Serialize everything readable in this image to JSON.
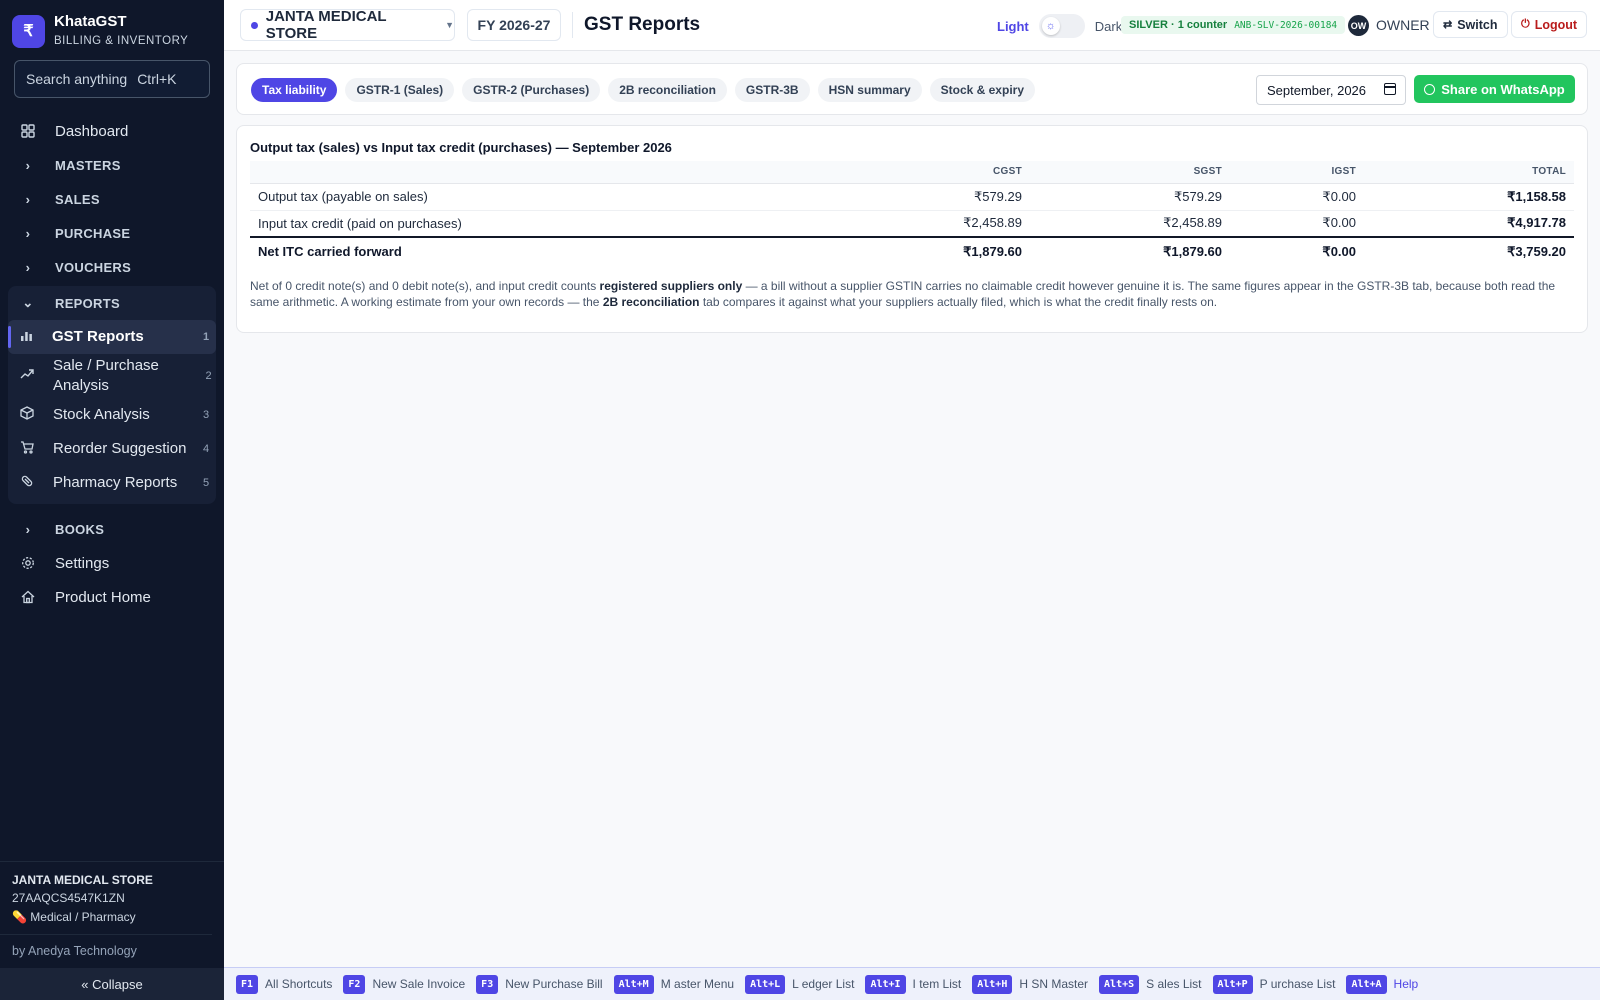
{
  "brand": {
    "logo": "₹",
    "name": "KhataGST",
    "subtitle": "BILLING & INVENTORY"
  },
  "search": {
    "placeholder": "Search anything",
    "shortcut": "Ctrl+K"
  },
  "sidebar": {
    "items": [
      {
        "label": "Dashboard",
        "icon": "grid-icon"
      },
      {
        "label": "MASTERS",
        "icon": "chevron-right-icon"
      },
      {
        "label": "SALES",
        "icon": "chevron-right-icon"
      },
      {
        "label": "PURCHASE",
        "icon": "chevron-right-icon"
      },
      {
        "label": "VOUCHERS",
        "icon": "chevron-right-icon"
      },
      {
        "label": "REPORTS",
        "icon": "chevron-down-icon"
      }
    ],
    "reports": [
      {
        "label": "GST Reports",
        "num": "1",
        "icon": "bar-chart-icon"
      },
      {
        "label": "Sale / Purchase Analysis",
        "num": "2",
        "icon": "trending-up-icon"
      },
      {
        "label": "Stock Analysis",
        "num": "3",
        "icon": "box-icon"
      },
      {
        "label": "Reorder Suggestion",
        "num": "4",
        "icon": "cart-icon"
      },
      {
        "label": "Pharmacy Reports",
        "num": "5",
        "icon": "pill-icon"
      }
    ],
    "after": [
      {
        "label": "BOOKS",
        "icon": "chevron-right-icon"
      },
      {
        "label": "Settings",
        "icon": "gear-icon"
      },
      {
        "label": "Product Home",
        "icon": "home-icon"
      }
    ],
    "store": {
      "name": "JANTA MEDICAL STORE",
      "gstin": "27AAQCS4547K1ZN",
      "category": "💊 Medical / Pharmacy"
    },
    "by": "by Anedya Technology",
    "collapse": "« Collapse"
  },
  "header": {
    "store": "JANTA MEDICAL STORE",
    "fy": "FY 2026-27",
    "title": "GST Reports",
    "theme_light": "Light",
    "theme_dark": "Dark",
    "plan": "SILVER · 1 counter",
    "license": "ANB-SLV-2026-00184",
    "avatar": "OW",
    "role": "OWNER",
    "switch": "Switch",
    "logout": "Logout"
  },
  "tabs": [
    "Tax liability",
    "GSTR-1 (Sales)",
    "GSTR-2 (Purchases)",
    "2B reconciliation",
    "GSTR-3B",
    "HSN summary",
    "Stock & expiry"
  ],
  "active_tab": "Tax liability",
  "month": "September, 2026",
  "whatsapp": "Share on WhatsApp",
  "report": {
    "title": "Output tax (sales) vs Input tax credit (purchases) — September 2026",
    "columns": [
      "",
      "CGST",
      "SGST",
      "IGST",
      "TOTAL"
    ],
    "rows": [
      [
        "Output tax (payable on sales)",
        "₹579.29",
        "₹579.29",
        "₹0.00",
        "₹1,158.58"
      ],
      [
        "Input tax credit (paid on purchases)",
        "₹2,458.89",
        "₹2,458.89",
        "₹0.00",
        "₹4,917.78"
      ]
    ],
    "net": [
      "Net ITC carried forward",
      "₹1,879.60",
      "₹1,879.60",
      "₹0.00",
      "₹3,759.20"
    ],
    "note": {
      "p1": "Net of 0 credit note(s) and 0 debit note(s), and input credit counts ",
      "b1": "registered suppliers only",
      "p2": " — a bill without a supplier GSTIN carries no claimable credit however genuine it is. The same figures appear in the GSTR-3B tab, because both read the same arithmetic. A working estimate from your own records — the ",
      "b2": "2B reconciliation",
      "p3": " tab compares it against what your suppliers actually filed, which is what the credit finally rests on."
    }
  },
  "shortcuts": [
    {
      "key": "F1",
      "label": "All Shortcuts"
    },
    {
      "key": "F2",
      "label": "New Sale Invoice"
    },
    {
      "key": "F3",
      "label": "New Purchase Bill"
    },
    {
      "key": "Alt+M",
      "label": "M aster Menu"
    },
    {
      "key": "Alt+L",
      "label": "L edger List"
    },
    {
      "key": "Alt+I",
      "label": "I tem List"
    },
    {
      "key": "Alt+H",
      "label": "H SN Master"
    },
    {
      "key": "Alt+S",
      "label": "S ales List"
    },
    {
      "key": "Alt+P",
      "label": "P urchase List"
    },
    {
      "key": "Alt+A",
      "label": "Help"
    }
  ],
  "colors": {
    "accent": "#4f46e5",
    "sidebar": "#0f172a",
    "whatsapp": "#22c55e",
    "logout": "#b91c1c"
  }
}
